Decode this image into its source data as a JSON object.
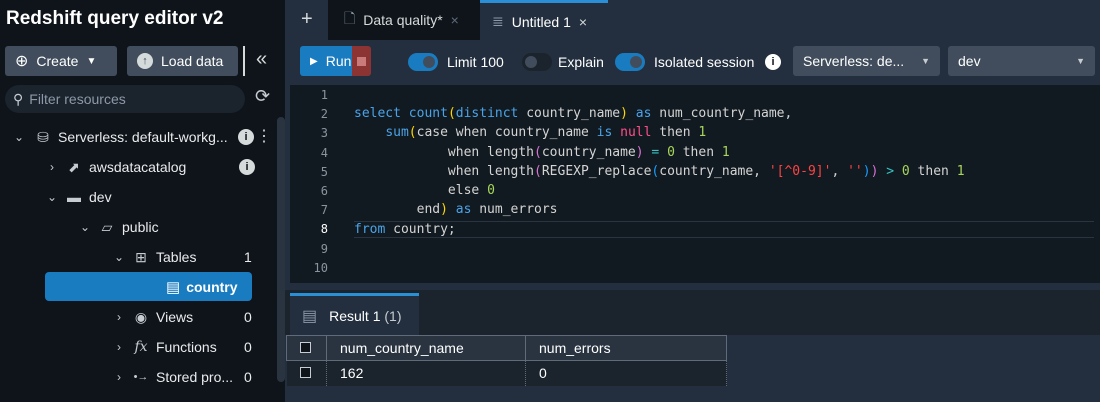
{
  "sidebar": {
    "title": "Redshift query editor v2",
    "create_label": "Create",
    "load_label": "Load data",
    "filter_placeholder": "Filter resources",
    "tree": [
      {
        "label": "Serverless: default-workg...",
        "icon": "serverless-icon",
        "expanded": true
      },
      {
        "label": "awsdatacatalog",
        "icon": "catalog-icon"
      },
      {
        "label": "dev",
        "icon": "folder-icon",
        "expanded": true
      },
      {
        "label": "public",
        "icon": "folder-open-icon",
        "expanded": true
      },
      {
        "label": "Tables",
        "icon": "tables-icon",
        "count": "1",
        "expanded": true
      },
      {
        "label": "country",
        "icon": "table-icon",
        "selected": true
      },
      {
        "label": "Views",
        "icon": "eye-icon",
        "count": "0"
      },
      {
        "label": "Functions",
        "icon": "function-icon",
        "count": "0"
      },
      {
        "label": "Stored pro...",
        "icon": "stored-procedure-icon",
        "count": "0"
      }
    ]
  },
  "tabs": [
    {
      "label": "Data quality*",
      "active": false
    },
    {
      "label": "Untitled 1",
      "active": true
    }
  ],
  "toolbar": {
    "run_label": "Run",
    "limit_label": "Limit 100",
    "limit_on": true,
    "explain_label": "Explain",
    "explain_on": false,
    "isolated_label": "Isolated session",
    "isolated_on": true,
    "workgroup_select": "Serverless: de...",
    "database_select": "dev"
  },
  "editor": {
    "lines": [
      [],
      [
        [
          "kw",
          "select "
        ],
        [
          "kw",
          "count"
        ],
        [
          "p1",
          "("
        ],
        [
          "kw",
          "distinct "
        ],
        [
          "id",
          "country_name"
        ],
        [
          "p1",
          ")"
        ],
        [
          "kw",
          " as "
        ],
        [
          "id",
          "num_country_name,"
        ]
      ],
      [
        [
          "id",
          "    "
        ],
        [
          "kw",
          "sum"
        ],
        [
          "p1",
          "("
        ],
        [
          "id",
          "case when country_name "
        ],
        [
          "kw",
          "is "
        ],
        [
          "null",
          "null"
        ],
        [
          "id",
          " then "
        ],
        [
          "num",
          "1"
        ]
      ],
      [
        [
          "id",
          "            when length"
        ],
        [
          "p2",
          "("
        ],
        [
          "id",
          "country_name"
        ],
        [
          "p2",
          ")"
        ],
        [
          "op",
          " = "
        ],
        [
          "num",
          "0"
        ],
        [
          "id",
          " then "
        ],
        [
          "num",
          "1"
        ]
      ],
      [
        [
          "id",
          "            when length"
        ],
        [
          "p2",
          "("
        ],
        [
          "id",
          "REGEXP_replace"
        ],
        [
          "p3",
          "("
        ],
        [
          "id",
          "country_name, "
        ],
        [
          "str",
          "'[^0-9]'"
        ],
        [
          "id",
          ", "
        ],
        [
          "str",
          "''"
        ],
        [
          "p3",
          ")"
        ],
        [
          "p2",
          ")"
        ],
        [
          "op",
          " > "
        ],
        [
          "num",
          "0"
        ],
        [
          "id",
          " then "
        ],
        [
          "num",
          "1"
        ]
      ],
      [
        [
          "id",
          "            else "
        ],
        [
          "num",
          "0"
        ]
      ],
      [
        [
          "id",
          "        end"
        ],
        [
          "p1",
          ")"
        ],
        [
          "kw",
          " as "
        ],
        [
          "id",
          "num_errors"
        ]
      ],
      [
        [
          "kw",
          "from "
        ],
        [
          "id",
          "country;"
        ]
      ],
      [],
      []
    ]
  },
  "results": {
    "tab_label": "Result 1",
    "tab_count": "(1)",
    "columns": [
      "num_country_name",
      "num_errors"
    ],
    "rows": [
      [
        "162",
        "0"
      ]
    ]
  },
  "colors": {
    "accent": "#0972d3",
    "stop": "#8c3333",
    "selected": "#1a7cc0"
  }
}
